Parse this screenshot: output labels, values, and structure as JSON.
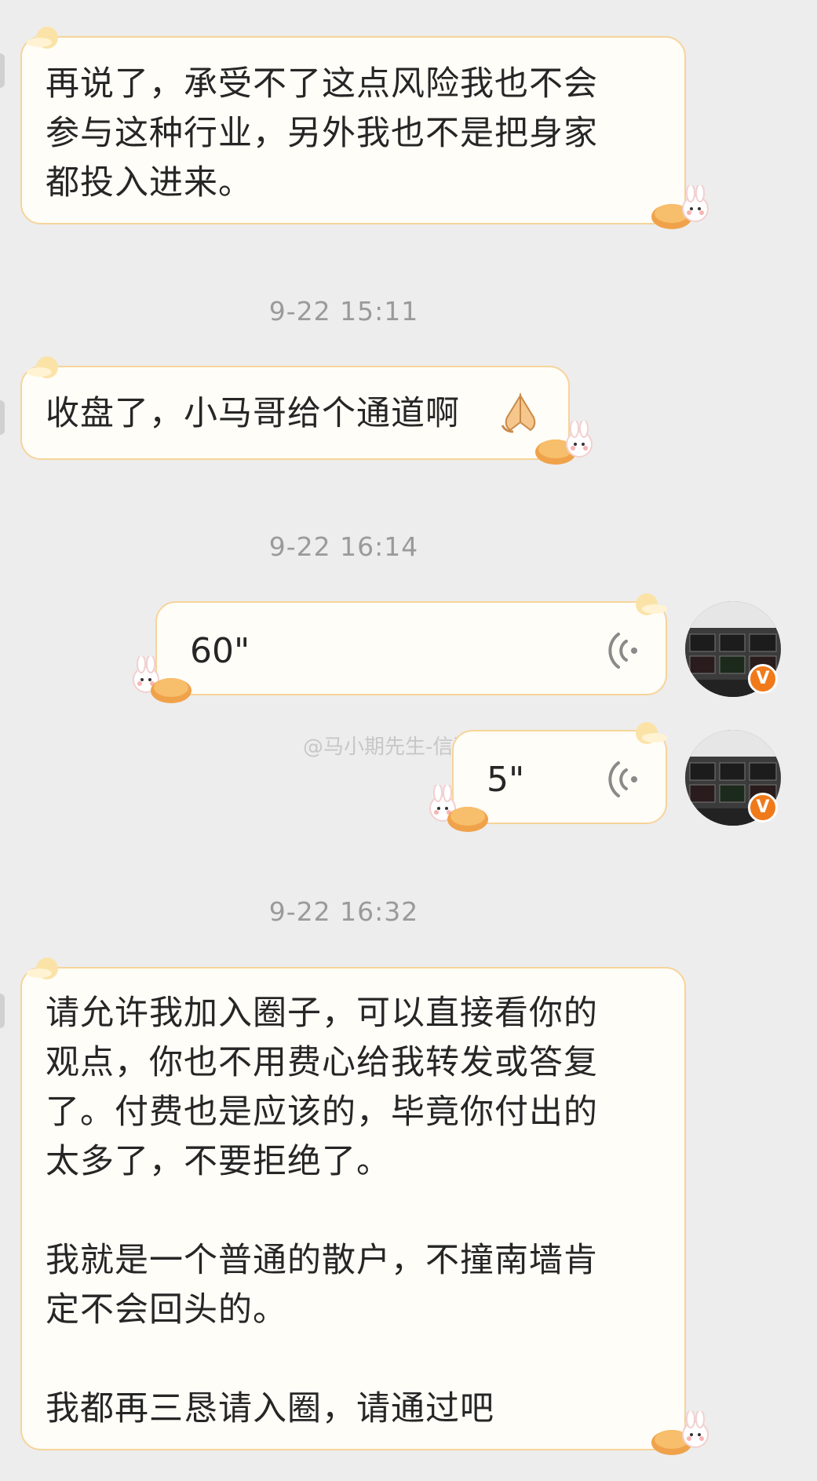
{
  "messages": [
    {
      "sender": "other",
      "type": "text",
      "text": "再说了，承受不了这点风险我也不会\n参与这种行业，另外我也不是把身家\n都投入进来。"
    },
    {
      "type": "timestamp",
      "text": "9-22 15:11"
    },
    {
      "sender": "other",
      "type": "text",
      "text": "收盘了，小马哥给个通道啊"
    },
    {
      "type": "timestamp",
      "text": "9-22 16:14"
    },
    {
      "sender": "self",
      "type": "voice",
      "duration": "60\""
    },
    {
      "sender": "self",
      "type": "voice",
      "duration": "5\""
    },
    {
      "type": "timestamp",
      "text": "9-22 16:32"
    },
    {
      "sender": "other",
      "type": "text",
      "text": "请允许我加入圈子，可以直接看你的\n观点，你也不用费心给我转发或答复\n了。付费也是应该的，毕竟你付出的\n太多了，不要拒绝了。\n\n我就是一个普通的散户，不撞南墙肯\n定不会回头的。\n\n我都再三恳请入圈，请通过吧"
    }
  ],
  "watermark": "@马小期先生-信道",
  "icons": {
    "emoji": "folded-hands-icon",
    "voice": "voice-wave-icon",
    "badge": "verified-v-badge-icon",
    "bubble_decor": "mooncake-rabbit-decoration"
  },
  "badge_letter": "V",
  "colors": {
    "background": "#ededed",
    "bubble_fill": "#fffdf7",
    "bubble_border": "#f6d49a",
    "timestamp": "#9a9a9a",
    "badge": "#f07a1a"
  }
}
